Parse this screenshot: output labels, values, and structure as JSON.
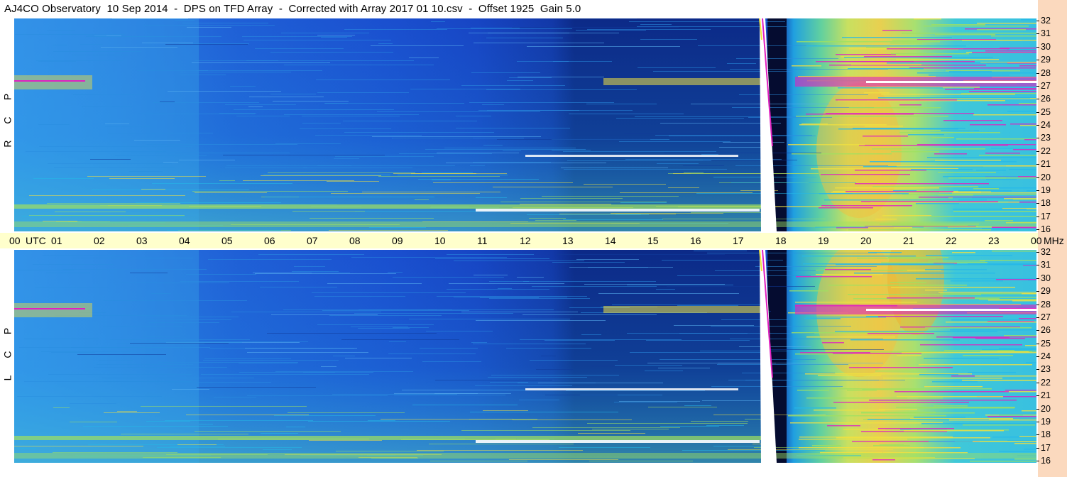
{
  "header": {
    "title": "AJ4CO Observatory  10 Sep 2014  -  DPS on TFD Array  -  Corrected with Array 2017 01 10.csv  -  Offset 1925  Gain 5.0"
  },
  "panels": {
    "top_label": [
      "R",
      "C",
      "P"
    ],
    "bottom_label": [
      "L",
      "C",
      "P"
    ]
  },
  "time_axis": {
    "utc_label": "UTC",
    "unit_label": "MHz",
    "ticks": [
      "00",
      "01",
      "02",
      "03",
      "04",
      "05",
      "06",
      "07",
      "08",
      "09",
      "10",
      "11",
      "12",
      "13",
      "14",
      "15",
      "16",
      "17",
      "18",
      "19",
      "20",
      "21",
      "22",
      "23",
      "00"
    ]
  },
  "freq_axis": {
    "ticks": [
      "32",
      "31",
      "30",
      "29",
      "28",
      "27",
      "26",
      "25",
      "24",
      "23",
      "22",
      "21",
      "20",
      "19",
      "18",
      "17",
      "16"
    ]
  },
  "colors": {
    "background": "#1e58d8",
    "quiet": "#1a4fd0",
    "cyan": "#25b8e8",
    "green": "#9fe060",
    "yellow": "#f0e040",
    "magenta": "#e020c0",
    "burst": "#ffffff",
    "timebar": "#ffffcc",
    "side": "#fbd9be"
  },
  "chart_data": {
    "type": "heatmap",
    "title": "AJ4CO Observatory  10 Sep 2014  -  DPS on TFD Array  -  Corrected with Array 2017 01 10.csv  -  Offset 1925  Gain 5.0",
    "xlabel": "UTC",
    "ylabel": "MHz",
    "x_range": [
      "00",
      "00"
    ],
    "y_range": [
      16,
      32
    ],
    "panels": [
      "RCP",
      "LCP"
    ],
    "burst_time_utc": "17:35",
    "burst_freq_range_mhz": [
      16,
      32
    ]
  }
}
